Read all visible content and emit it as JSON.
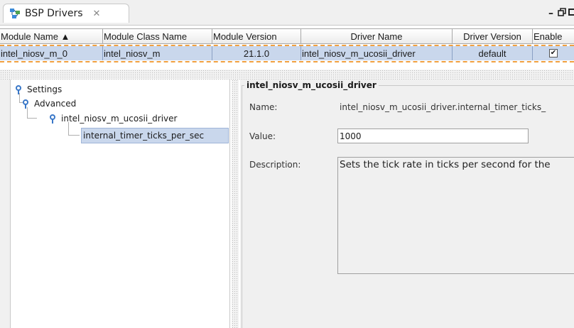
{
  "tab": {
    "title": "BSP Drivers",
    "close_glyph": "✕"
  },
  "window_controls": {
    "minimize": "–",
    "maximize": "❐",
    "restore": "□"
  },
  "table": {
    "headers": {
      "module_name": "Module Name ▲",
      "module_class_name": "Module Class Name",
      "module_version": "Module Version",
      "driver_name": "Driver Name",
      "driver_version": "Driver Version",
      "enable": "Enable"
    },
    "row": {
      "module_name": "intel_niosv_m_0",
      "module_class_name": "intel_niosv_m",
      "module_version": "21.1.0",
      "driver_name": "intel_niosv_m_ucosii_driver",
      "driver_version": "default",
      "enable_mark": "✔"
    }
  },
  "tree": {
    "settings": "Settings",
    "advanced": "Advanced",
    "driver": "intel_niosv_m_ucosii_driver",
    "leaf": "internal_timer_ticks_per_sec"
  },
  "detail": {
    "group_title": "intel_niosv_m_ucosii_driver",
    "name_label": "Name:",
    "name_value": "intel_niosv_m_ucosii_driver.internal_timer_ticks_",
    "value_label": "Value:",
    "value": "1000",
    "description_label": "Description:",
    "description": "Sets the tick rate in ticks per second for the"
  }
}
